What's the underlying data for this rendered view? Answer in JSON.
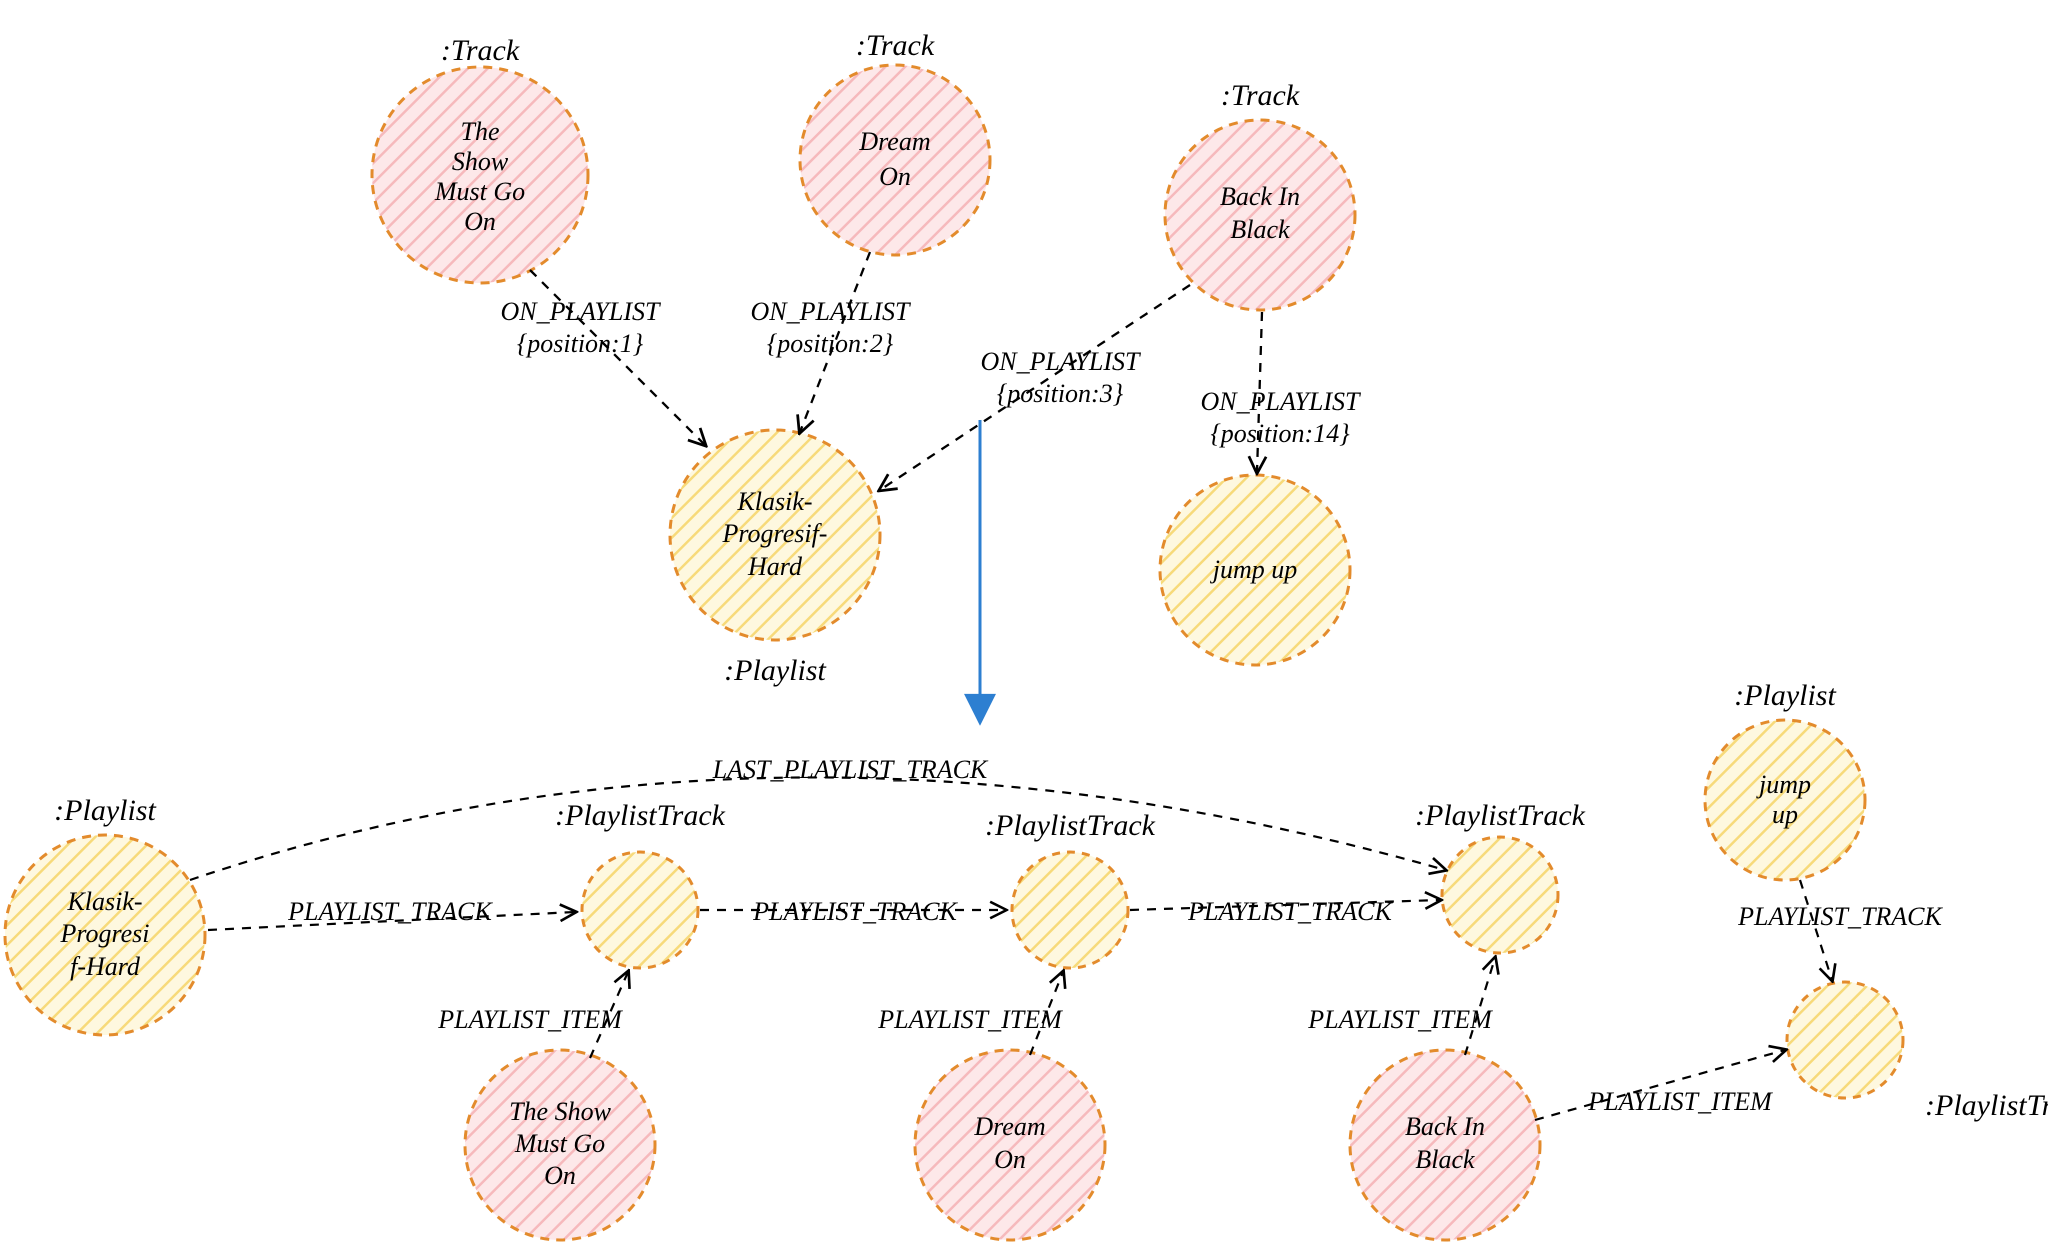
{
  "types": {
    "track": ":Track",
    "playlist": ":Playlist",
    "playlistTrack": ":PlaylistTrack"
  },
  "edges": {
    "onPlaylist": "ON_PLAYLIST",
    "pos1": "{position:1}",
    "pos2": "{position:2}",
    "pos3": "{position:3}",
    "pos14": "{position:14}",
    "lastPlaylistTrack": "LAST_PLAYLIST_TRACK",
    "playlistTrack": "PLAYLIST_TRACK",
    "playlistItem": "PLAYLIST_ITEM"
  },
  "top": {
    "track1": {
      "lines": [
        "The",
        "Show",
        "Must Go",
        "On"
      ]
    },
    "track2": {
      "lines": [
        "Dream",
        "On"
      ]
    },
    "track3": {
      "lines": [
        "Back In",
        "Black"
      ]
    },
    "playlist1": {
      "lines": [
        "Klasik-",
        "Progresif-",
        "Hard"
      ]
    },
    "playlist2": {
      "lines": [
        "jump up"
      ]
    }
  },
  "bottom": {
    "playlistA": {
      "lines": [
        "Klasik-",
        "Progresi",
        "f-Hard"
      ]
    },
    "playlistB": {
      "lines": [
        "jump",
        "up"
      ]
    },
    "trackA": {
      "lines": [
        "The Show",
        "Must Go",
        "On"
      ]
    },
    "trackB": {
      "lines": [
        "Dream",
        "On"
      ]
    },
    "trackC": {
      "lines": [
        "Back In",
        "Black"
      ]
    }
  }
}
